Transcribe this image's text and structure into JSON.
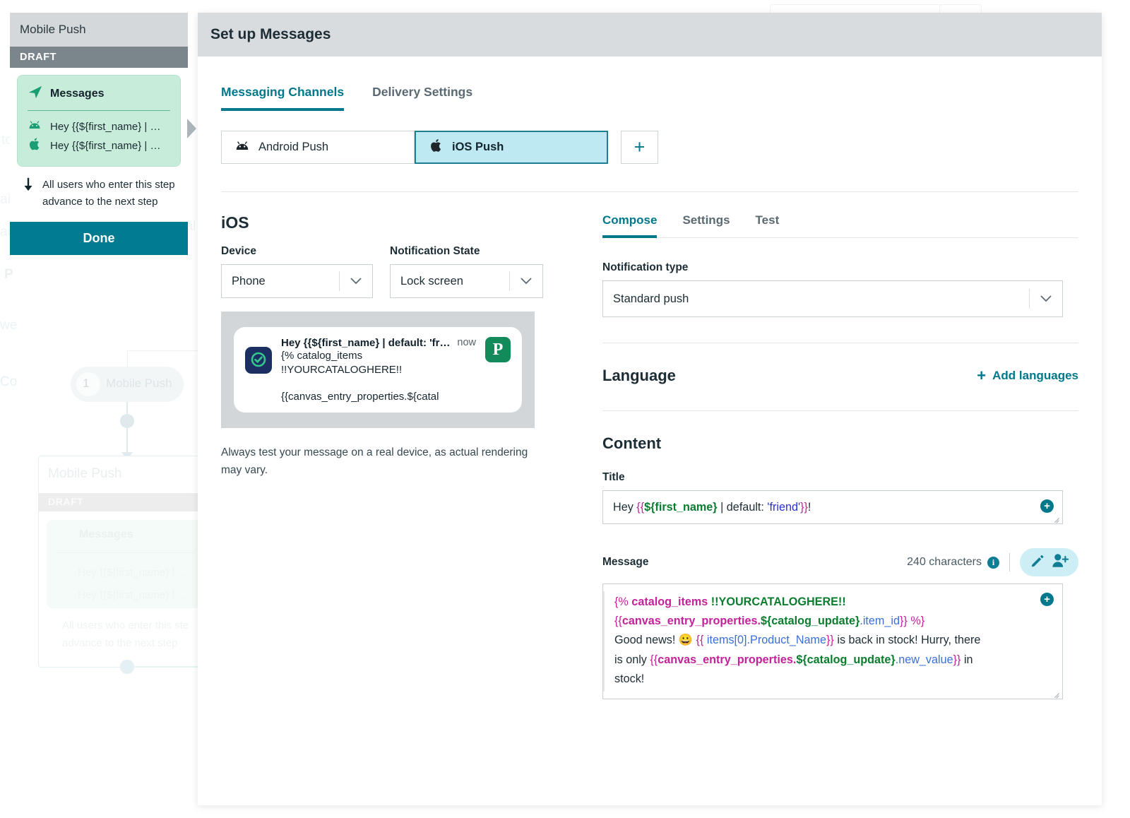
{
  "background": {
    "node_label": "Mobile Push",
    "node_number": "1",
    "ghost_card": {
      "title": "Mobile Push",
      "draft": "DRAFT",
      "messages": "Messages",
      "row1": "Hey {{${first_name} | ...",
      "row2": "Hey {{${first_name} | ...",
      "advance": "All users who enter this ste",
      "advance2": "advance to the next step"
    },
    "ghost_words": [
      "to",
      "ai",
      "ai",
      "P",
      "we",
      "Co",
      "nal"
    ]
  },
  "step_panel": {
    "title": "Mobile Push",
    "status": "DRAFT",
    "card_title": "Messages",
    "messages": [
      {
        "icon": "android-icon",
        "label": "Hey {{${first_name} | …"
      },
      {
        "icon": "apple-icon",
        "label": "Hey {{${first_name} | …"
      }
    ],
    "advance_text": "All users who enter this step advance to the next step",
    "done_label": "Done"
  },
  "modal": {
    "title": "Set up Messages",
    "tabs": [
      {
        "label": "Messaging Channels",
        "active": true
      },
      {
        "label": "Delivery Settings",
        "active": false
      }
    ],
    "channels": [
      {
        "label": "Android Push",
        "icon": "android-icon",
        "selected": false
      },
      {
        "label": "iOS Push",
        "icon": "apple-icon",
        "selected": true
      }
    ],
    "add_channel_label": "+"
  },
  "preview": {
    "heading": "iOS",
    "device": {
      "label": "Device",
      "value": "Phone"
    },
    "state": {
      "label": "Notification State",
      "value": "Lock screen"
    },
    "notification": {
      "title": "Hey {{${first_name} | default: 'frien…",
      "time": "now",
      "body_line1": "{% catalog_items",
      "body_line2": "!!YOURCATALOGHERE!!",
      "body_line3": "{{canvas_entry_properties.${catal",
      "app_icon": "shield-check-icon",
      "badge_letter": "P"
    },
    "disclaimer": "Always test your message on a real device, as actual rendering may vary."
  },
  "compose": {
    "tabs": [
      {
        "label": "Compose",
        "active": true
      },
      {
        "label": "Settings",
        "active": false
      },
      {
        "label": "Test",
        "active": false
      }
    ],
    "notification_type": {
      "label": "Notification type",
      "value": "Standard push"
    },
    "language": {
      "heading": "Language",
      "add_label": "Add languages",
      "plus": "+"
    },
    "content": {
      "heading": "Content",
      "title_label": "Title",
      "title_value": {
        "plain_prefix": "Hey ",
        "open_brace": "{{",
        "variable": "${first_name}",
        "pipe": " | default: ",
        "string": "'friend'",
        "close_brace": "}}",
        "suffix": "!"
      },
      "message_label": "Message",
      "char_count": "240 characters",
      "info_glyph": "i",
      "message_lines": [
        [
          {
            "t": "{%",
            "c": "brace"
          },
          {
            "t": " catalog_items",
            "c": "key"
          },
          {
            "t": " !!YOURCATALOGHERE!!",
            "c": "green"
          }
        ],
        [
          {
            "t": "{{",
            "c": "brace"
          },
          {
            "t": "canvas_entry_properties.",
            "c": "key"
          },
          {
            "t": "${catalog_update}",
            "c": "green"
          },
          {
            "t": ".item_id",
            "c": "prop"
          },
          {
            "t": "}}",
            "c": "brace"
          },
          {
            "t": " %}",
            "c": "brace"
          }
        ],
        [
          {
            "t": "Good news! 😀 ",
            "c": "plain"
          },
          {
            "t": "{{",
            "c": "brace"
          },
          {
            "t": " items[0].Product_Name",
            "c": "prop"
          },
          {
            "t": "}}",
            "c": "brace"
          },
          {
            "t": " is back in stock! Hurry, there",
            "c": "plain"
          }
        ],
        [
          {
            "t": "is only ",
            "c": "plain"
          },
          {
            "t": "{{",
            "c": "brace"
          },
          {
            "t": "canvas_entry_properties.",
            "c": "key"
          },
          {
            "t": "${catalog_update}",
            "c": "green"
          },
          {
            "t": ".new_value",
            "c": "prop"
          },
          {
            "t": "}}",
            "c": "brace"
          },
          {
            "t": " in",
            "c": "plain"
          }
        ],
        [
          {
            "t": "stock!",
            "c": "plain"
          }
        ]
      ]
    },
    "icons": {
      "pencil": "pencil-icon",
      "add_user": "add-user-icon",
      "plus": "+"
    }
  },
  "colors": {
    "accent": "#00788c",
    "selected_channel_bg": "#bfe9f2",
    "draft_bar": "#7a868c",
    "message_card": "#c8ecda",
    "done_button": "#007b8f"
  }
}
